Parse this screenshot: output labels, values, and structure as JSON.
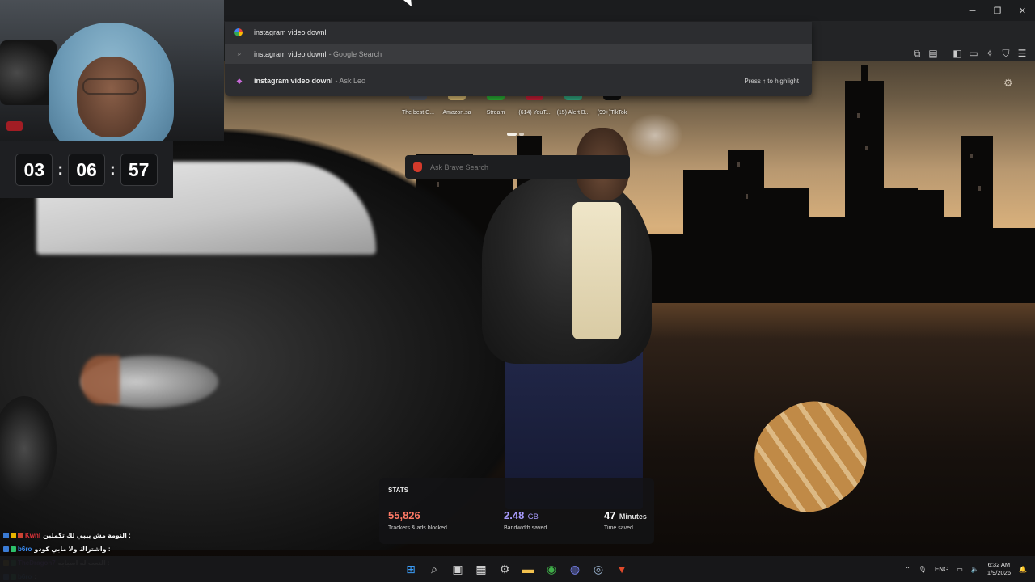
{
  "browser": {
    "omnibox": {
      "value": "instagram video downl"
    },
    "suggestions": [
      {
        "text": "instagram video downl",
        "source": " - Google Search",
        "icon": "search-icon"
      },
      {
        "text": "instagram video downl",
        "source": " - Ask Leo",
        "icon": "leo-icon",
        "hint": "Press ↑ to highlight"
      }
    ],
    "window_controls": {
      "minimize": "─",
      "restore": "❐",
      "close": "✕"
    }
  },
  "newtab": {
    "top_sites": [
      {
        "label": "The best C...",
        "color": "#555a66"
      },
      {
        "label": "Amazon.sa",
        "color": "#e9c87a"
      },
      {
        "label": "Stream",
        "color": "#2fbf3a"
      },
      {
        "label": "(614) YouT...",
        "color": "#d8203a"
      },
      {
        "label": "(15) Alert B...",
        "color": "#36b58a"
      },
      {
        "label": "(99+)TikTok",
        "color": "#111111"
      }
    ],
    "search_placeholder": "Ask Brave Search",
    "stats": {
      "title": "STATS",
      "trackers": {
        "value": "55,826",
        "label": "Trackers & ads blocked",
        "color": "#ff7a66"
      },
      "bandwidth": {
        "value": "2.48",
        "unit": "GB",
        "label": "Bandwidth saved",
        "color": "#a99cff"
      },
      "time": {
        "value": "47",
        "unit": "Minutes",
        "label": "Time saved",
        "color": "#ffffff"
      }
    }
  },
  "stream_overlay": {
    "timer": {
      "hours": "03",
      "minutes": "06",
      "seconds": "57",
      "separator": ":"
    },
    "chat": [
      {
        "author": "Kwnl",
        "author_color": "#e0333a",
        "message": "النومة مش بيبي لك تكملين :",
        "badges": [
          "#3a7bd5",
          "#e8b400",
          "#c43"
        ]
      },
      {
        "author": "b6ro",
        "author_color": "#3a8df5",
        "message": "واشتراك ولا مابي كودو :",
        "badges": [
          "#3a7bd5",
          "#2dbf6a"
        ]
      },
      {
        "author": "TheDragon7",
        "author_color": "#9b59ff",
        "message": "التعب له اسبابه :",
        "badges": [
          "#e8b400",
          "#2dbf6a"
        ]
      },
      {
        "author": "b6ro",
        "author_color": "#3a8df5",
        "message": ":",
        "badges": [
          "#3a7bd5",
          "#2dbf6a"
        ]
      }
    ]
  },
  "taskbar": {
    "apps": [
      {
        "name": "windows-start-icon",
        "glyph": "⊞",
        "color": "#3a9bf5"
      },
      {
        "name": "search-icon",
        "glyph": "⌕",
        "color": "#e6e6e6"
      },
      {
        "name": "task-view-icon",
        "glyph": "▣",
        "color": "#d0d0d0"
      },
      {
        "name": "store-icon",
        "glyph": "▦",
        "color": "#e6e6e6"
      },
      {
        "name": "settings-app-icon",
        "glyph": "⚙",
        "color": "#c0c0c0"
      },
      {
        "name": "file-explorer-icon",
        "glyph": "▬",
        "color": "#f2c14e"
      },
      {
        "name": "chrome-icon",
        "glyph": "◉",
        "color": "#3fae49"
      },
      {
        "name": "discord-icon",
        "glyph": "◍",
        "color": "#7b86f5"
      },
      {
        "name": "steam-icon",
        "glyph": "◎",
        "color": "#9fb9d6"
      },
      {
        "name": "brave-icon",
        "glyph": "▼",
        "color": "#e24a2b"
      }
    ],
    "language": "ENG",
    "time": "6:32 AM",
    "date": "1/9/2026"
  }
}
